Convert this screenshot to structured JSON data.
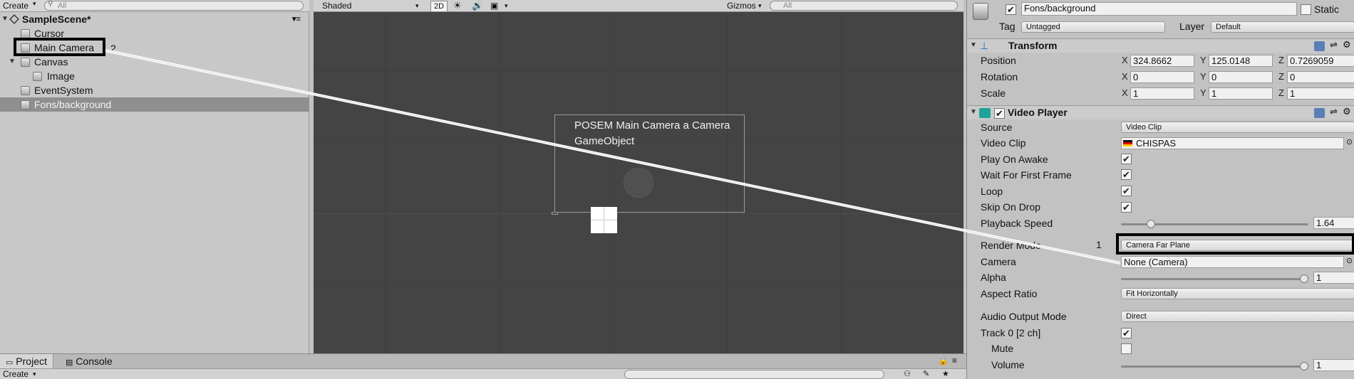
{
  "hierarchy": {
    "create_label": "Create",
    "search_placeholder": "All",
    "scene_name": "SampleScene*",
    "items": [
      {
        "label": "Cursor"
      },
      {
        "label": "Main Camera"
      },
      {
        "label": "Canvas"
      },
      {
        "label": "Image"
      },
      {
        "label": "EventSystem"
      },
      {
        "label": "Fons/background"
      }
    ]
  },
  "scene": {
    "shading": "Shaded",
    "mode_2d": "2D",
    "gizmos": "Gizmos",
    "search_placeholder": "All",
    "tooltip_line1": "POSEM Main Camera a Camera",
    "tooltip_line2": "GameObject"
  },
  "annotations": {
    "label_1": "1",
    "label_2": "2"
  },
  "inspector": {
    "object_name": "Fons/background",
    "static_label": "Static",
    "tag_label": "Tag",
    "tag_value": "Untagged",
    "layer_label": "Layer",
    "layer_value": "Default",
    "transform": {
      "title": "Transform",
      "position_label": "Position",
      "rotation_label": "Rotation",
      "scale_label": "Scale",
      "position": {
        "x": "324.8662",
        "y": "125.0148",
        "z": "0.7269059"
      },
      "rotation": {
        "x": "0",
        "y": "0",
        "z": "0"
      },
      "scale": {
        "x": "1",
        "y": "1",
        "z": "1"
      },
      "axis_x": "X",
      "axis_y": "Y",
      "axis_z": "Z"
    },
    "video_player": {
      "title": "Video Player",
      "source_label": "Source",
      "source_value": "Video Clip",
      "video_clip_label": "Video Clip",
      "video_clip_value": "CHISPAS",
      "play_on_awake_label": "Play On Awake",
      "wait_first_frame_label": "Wait For First Frame",
      "loop_label": "Loop",
      "skip_on_drop_label": "Skip On Drop",
      "playback_speed_label": "Playback Speed",
      "playback_speed_value": "1.64",
      "playback_speed_fraction": 0.16,
      "render_mode_label": "Render Mode",
      "render_mode_value": "Camera Far Plane",
      "camera_label": "Camera",
      "camera_value": "None (Camera)",
      "alpha_label": "Alpha",
      "alpha_value": "1",
      "aspect_ratio_label": "Aspect Ratio",
      "aspect_ratio_value": "Fit Horizontally",
      "audio_output_label": "Audio Output Mode",
      "audio_output_value": "Direct",
      "track_label": "Track 0 [2 ch]",
      "mute_label": "Mute",
      "volume_label": "Volume",
      "volume_value": "1"
    }
  },
  "bottom": {
    "project_tab": "Project",
    "console_tab": "Console",
    "create_label": "Create"
  }
}
